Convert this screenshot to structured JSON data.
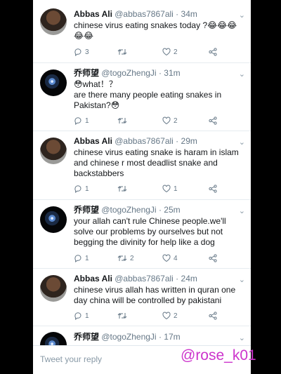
{
  "tweets": [
    {
      "name": "Abbas Ali",
      "handle": "@abbas7867ali",
      "time": "34m",
      "text": "chinese virus eating snakes today ?😂😂😂\n😂😂",
      "replies": "3",
      "retweets": "",
      "likes": "2",
      "avatar": "photo-avatar"
    },
    {
      "name": "乔师望",
      "handle": "@togoZhengJi",
      "time": "31m",
      "text": "😳what！？\nare there many people eating snakes in\nPakistan?😳",
      "replies": "1",
      "retweets": "",
      "likes": "2",
      "avatar": "planet-avatar"
    },
    {
      "name": "Abbas Ali",
      "handle": "@abbas7867ali",
      "time": "29m",
      "text": "chinese virus eating snake is haram in islam\nand chinese r most deadlist snake and\nbackstabbers",
      "replies": "1",
      "retweets": "",
      "likes": "1",
      "avatar": "photo-avatar"
    },
    {
      "name": "乔师望",
      "handle": "@togoZhengJi",
      "time": "25m",
      "text": "your allah can't rule Chinese people.we'll\nsolve our problems by ourselves but not\nbegging the divinity for help like a dog",
      "replies": "1",
      "retweets": "2",
      "likes": "4",
      "avatar": "planet-avatar"
    },
    {
      "name": "Abbas Ali",
      "handle": "@abbas7867ali",
      "time": "24m",
      "text": "chinese virus allah has written in quran one\nday china will be controlled by pakistani",
      "replies": "1",
      "retweets": "",
      "likes": "2",
      "avatar": "photo-avatar"
    },
    {
      "name": "乔师望",
      "handle": "@togoZhengJi",
      "time": "17m",
      "text": "",
      "replies": "",
      "retweets": "",
      "likes": "",
      "avatar": "planet-avatar"
    }
  ],
  "compose": {
    "placeholder": "Tweet your reply"
  },
  "watermark": "@rose_k01",
  "colors": {
    "text": "#14171a",
    "secondary": "#657786",
    "watermark": "#cc33cc"
  }
}
